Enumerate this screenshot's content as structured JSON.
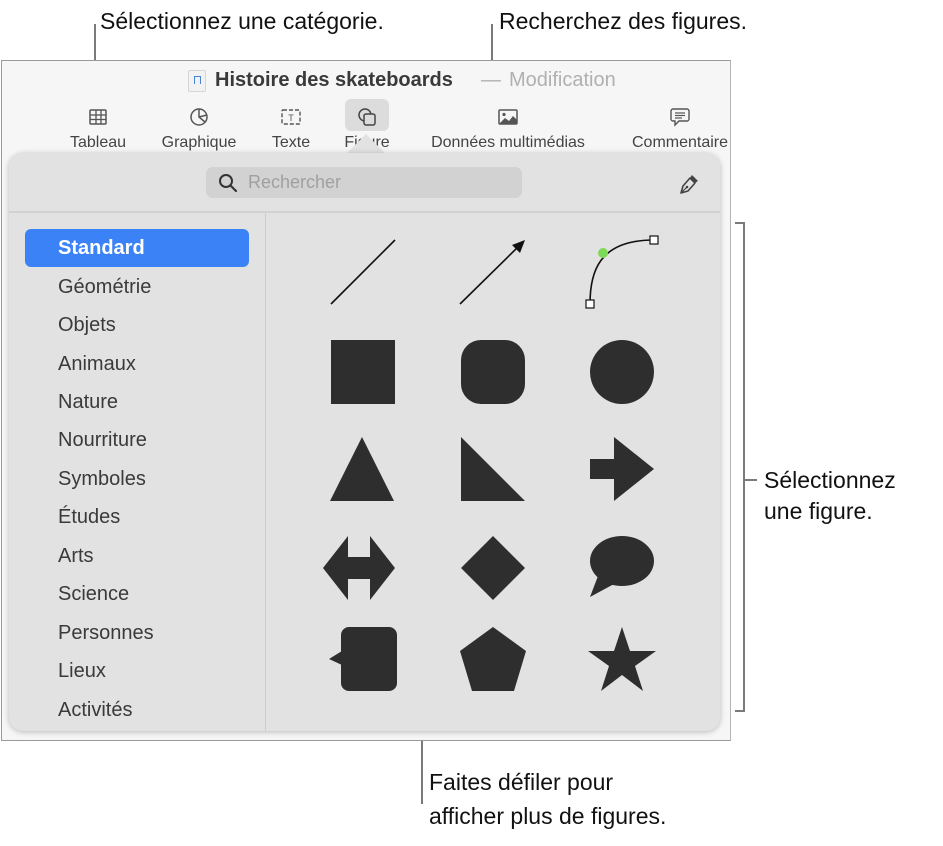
{
  "callouts": {
    "category": "Sélectionnez une catégorie.",
    "search": "Recherchez des figures.",
    "figure_line1": "Sélectionnez",
    "figure_line2": "une figure.",
    "scroll_line1": "Faites défiler pour",
    "scroll_line2": "afficher plus de figures."
  },
  "window": {
    "title": "Histoire des skateboards",
    "separator": "—",
    "status": "Modification"
  },
  "toolbar": [
    {
      "label": "Tableau",
      "icon": "table-icon"
    },
    {
      "label": "Graphique",
      "icon": "chart-icon"
    },
    {
      "label": "Texte",
      "icon": "text-box-icon"
    },
    {
      "label": "Figure",
      "icon": "shape-icon",
      "active": true
    },
    {
      "label": "Données multimédias",
      "icon": "media-icon"
    },
    {
      "label": "Commentaire",
      "icon": "comment-icon"
    }
  ],
  "popover": {
    "search_placeholder": "Rechercher",
    "search_value": "",
    "pen_tool": "pen-icon",
    "categories": [
      {
        "label": "Standard",
        "selected": true
      },
      {
        "label": "Géométrie"
      },
      {
        "label": "Objets"
      },
      {
        "label": "Animaux"
      },
      {
        "label": "Nature"
      },
      {
        "label": "Nourriture"
      },
      {
        "label": "Symboles"
      },
      {
        "label": "Études"
      },
      {
        "label": "Arts"
      },
      {
        "label": "Science"
      },
      {
        "label": "Personnes"
      },
      {
        "label": "Lieux"
      },
      {
        "label": "Activités"
      }
    ],
    "shapes": [
      "line",
      "arrow",
      "curve",
      "square",
      "rounded-square",
      "circle",
      "triangle",
      "right-triangle",
      "arrow-right",
      "double-arrow",
      "diamond",
      "speech-bubble",
      "callout-square",
      "pentagon",
      "star"
    ],
    "colors": {
      "accent": "#3b82f7",
      "shape_fill": "#2e2e2e",
      "curve_node": "#7ed957"
    }
  }
}
